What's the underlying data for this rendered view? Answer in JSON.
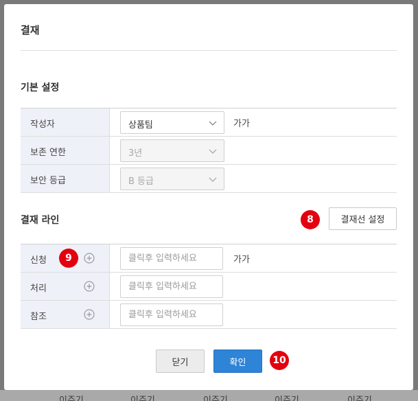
{
  "dialog": {
    "title": "결재"
  },
  "basic": {
    "section_title": "기본 설정",
    "rows": [
      {
        "label": "작성자",
        "value": "상품팀",
        "side_text": "가가",
        "disabled": false
      },
      {
        "label": "보존 연한",
        "value": "3년",
        "side_text": "",
        "disabled": true
      },
      {
        "label": "보안 등급",
        "value": "B 등급",
        "side_text": "",
        "disabled": true
      }
    ]
  },
  "approval": {
    "section_title": "결재 라인",
    "settings_button": "결재선 설정",
    "rows": [
      {
        "label": "신청",
        "placeholder": "클릭후 입력하세요",
        "side_text": "가가"
      },
      {
        "label": "처리",
        "placeholder": "클릭후 입력하세요",
        "side_text": ""
      },
      {
        "label": "참조",
        "placeholder": "클릭후 입력하세요",
        "side_text": ""
      }
    ]
  },
  "footer": {
    "close_label": "닫기",
    "confirm_label": "확인"
  },
  "badges": {
    "b8": "8",
    "b9": "9",
    "b10": "10"
  },
  "backdrop": {
    "tab_text": "이주기"
  },
  "colors": {
    "accent_blue": "#2e84d6",
    "badge_red": "#e3000f",
    "label_bg": "#eef1f8"
  },
  "icons": {
    "dropdown": "chevron-down-icon",
    "add": "plus-circle-icon"
  }
}
